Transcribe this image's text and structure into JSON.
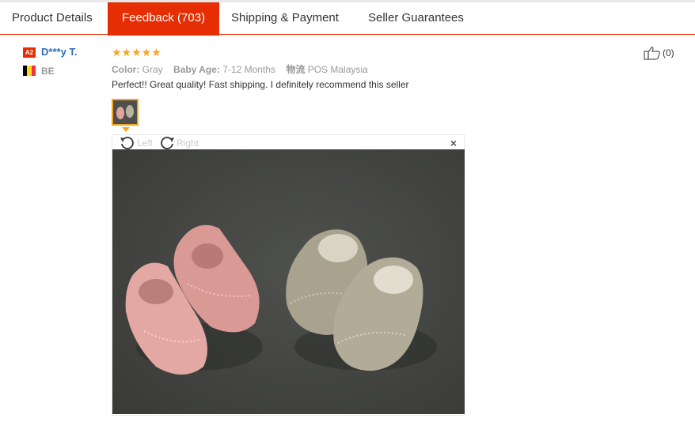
{
  "tabs": [
    {
      "label": "Product Details",
      "active": false
    },
    {
      "label": "Feedback (703)",
      "active": true
    },
    {
      "label": "Shipping & Payment",
      "active": false
    },
    {
      "label": "Seller Guarantees",
      "active": false
    }
  ],
  "review": {
    "level_badge": "A2",
    "username": "D***y T.",
    "country": "BE",
    "stars": "★★★★★",
    "rating": 5,
    "attributes": [
      {
        "label": "Color:",
        "value": "Gray"
      },
      {
        "label": "Baby Age:",
        "value": "7-12 Months"
      },
      {
        "label": "物流",
        "value": "POS Malaysia"
      }
    ],
    "text": "Perfect!! Great quality! Fast shipping. I definitely recommend this seller",
    "helpful_count": "(0)"
  },
  "viewer": {
    "rotate_left": "Left",
    "rotate_right": "Right",
    "close": "×"
  },
  "colors": {
    "accent": "#e62e04",
    "username": "#2d6fb7",
    "star": "#f5a623"
  }
}
